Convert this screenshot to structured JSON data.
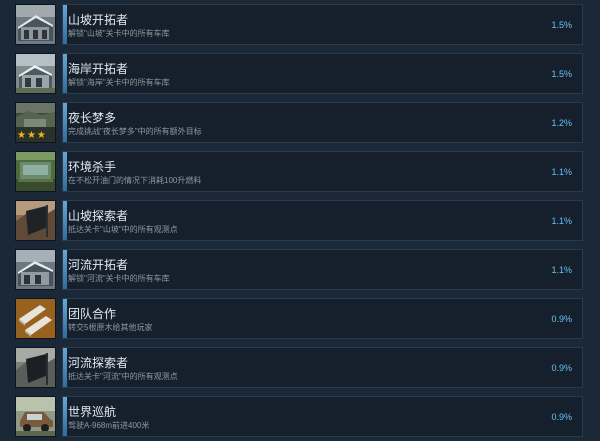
{
  "achievements": [
    {
      "title": "山坡开拓者",
      "desc": "解锁\"山坡\"关卡中的所有车库",
      "percent": "1.5%",
      "percent_value": 1.5,
      "icon": "snowy-garage-icon"
    },
    {
      "title": "海岸开拓者",
      "desc": "解锁\"海岸\"关卡中的所有车库",
      "percent": "1.5%",
      "percent_value": 1.5,
      "icon": "coast-garage-icon"
    },
    {
      "title": "夜长梦多",
      "desc": "完成挑战\"夜长梦多\"中的所有额外目标",
      "percent": "1.2%",
      "percent_value": 1.2,
      "icon": "three-stars-challenge-icon"
    },
    {
      "title": "环境杀手",
      "desc": "在不松开油门的情况下消耗100升燃料",
      "percent": "1.1%",
      "percent_value": 1.1,
      "icon": "swamp-truck-icon"
    },
    {
      "title": "山坡探索者",
      "desc": "抵达关卡\"山坡\"中的所有观测点",
      "percent": "1.1%",
      "percent_value": 1.1,
      "icon": "mountain-flag-icon"
    },
    {
      "title": "河流开拓者",
      "desc": "解锁\"河流\"关卡中的所有车库",
      "percent": "1.1%",
      "percent_value": 1.1,
      "icon": "river-garage-icon"
    },
    {
      "title": "团队合作",
      "desc": "转交5根原木给其他玩家",
      "percent": "0.9%",
      "percent_value": 0.9,
      "icon": "logs-icon"
    },
    {
      "title": "河流探索者",
      "desc": "抵达关卡\"河流\"中的所有观测点",
      "percent": "0.9%",
      "percent_value": 0.9,
      "icon": "river-flag-icon"
    },
    {
      "title": "世界巡航",
      "desc": "驾驶A-968m前进400米",
      "percent": "0.9%",
      "percent_value": 0.9,
      "icon": "vintage-car-icon"
    }
  ],
  "stars_label": "★★★"
}
